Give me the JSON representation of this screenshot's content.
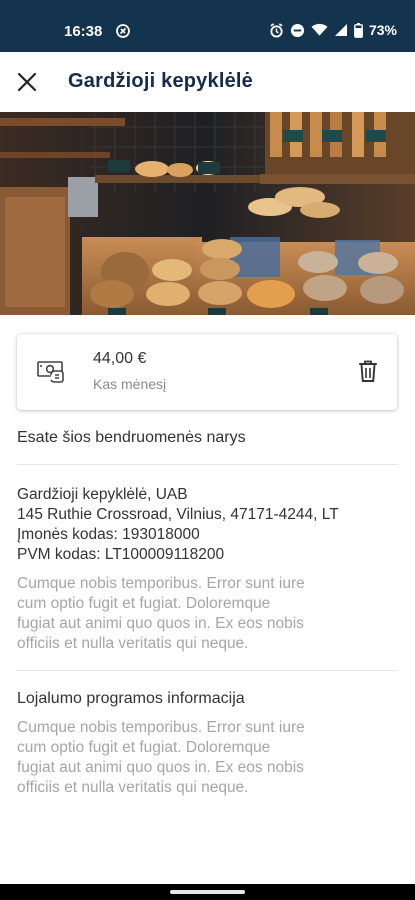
{
  "status_bar": {
    "time": "16:38",
    "battery": "73%"
  },
  "header": {
    "title": "Gardžioji kepyklėlė"
  },
  "subscription": {
    "amount": "44,00 €",
    "period": "Kas mėnesį"
  },
  "membership": {
    "text": "Esate šios bendruomenės narys"
  },
  "company": {
    "name": "Gardžioji kepyklėlė, UAB",
    "address": "145 Ruthie Crossroad, Vilnius, 47171-4244, LT",
    "company_code": "Įmonės kodas: 193018000",
    "vat_code": "PVM kodas: LT100009118200",
    "description_lines": [
      "Cumque nobis temporibus. Error sunt iure",
      "cum optio fugit et fugiat. Doloremque",
      "fugiat aut animi quo quos in. Ex eos nobis",
      "officiis et nulla veritatis qui neque."
    ]
  },
  "loyalty": {
    "title": "Lojalumo programos informacija",
    "description_lines": [
      "Cumque nobis temporibus. Error sunt iure",
      "cum optio fugit et fugiat. Doloremque",
      "fugiat aut animi quo quos in. Ex eos nobis",
      "officiis et nulla veritatis qui neque."
    ]
  },
  "icons": {
    "close": "close-icon",
    "money": "money-icon",
    "trash": "trash-icon",
    "alarm": "alarm-icon",
    "dnd": "do-not-disturb-icon",
    "wifi": "wifi-icon",
    "signal": "signal-icon",
    "battery": "battery-icon"
  },
  "colors": {
    "status_bar": "#13334f",
    "title": "#172c4a",
    "muted_text": "#a6a6a6"
  }
}
